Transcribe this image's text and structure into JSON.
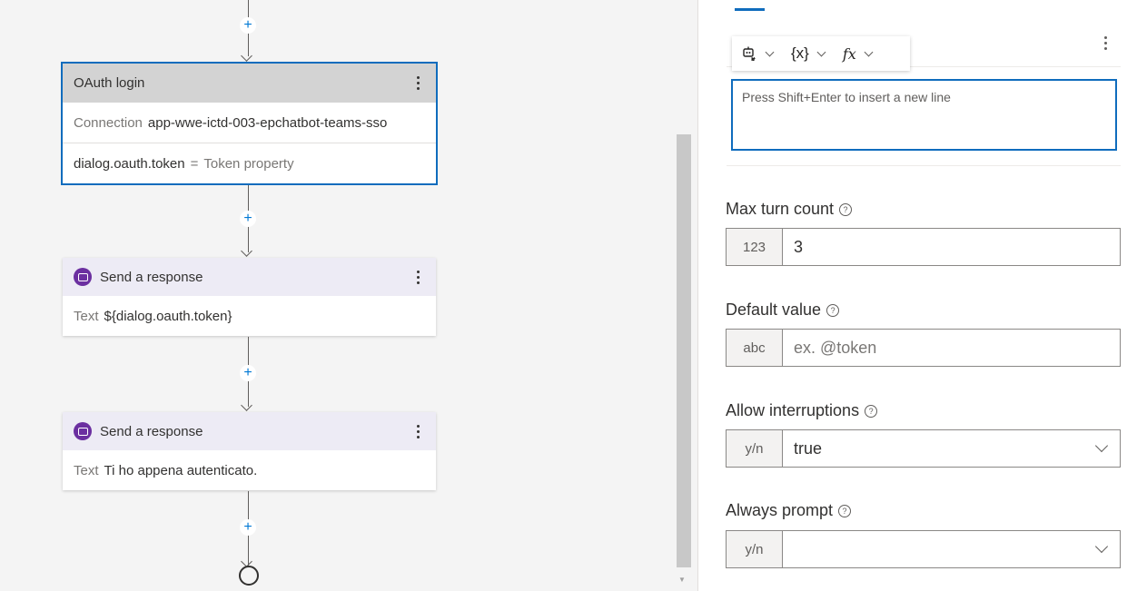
{
  "canvas": {
    "oauth_node": {
      "title": "OAuth login",
      "connection_label": "Connection",
      "connection_value": "app-wwe-ictd-003-epchatbot-teams-sso",
      "token_var": "dialog.oauth.token",
      "token_eq": "=",
      "token_prop": "Token property"
    },
    "response_nodes": [
      {
        "title": "Send a response",
        "text_label": "Text",
        "text_value": "${dialog.oauth.token}"
      },
      {
        "title": "Send a response",
        "text_label": "Text",
        "text_value": "Ti ho appena autenticato."
      }
    ],
    "add_symbol": "+"
  },
  "panel": {
    "toolbar": {
      "var_label": "{x}",
      "fx_label": "fx"
    },
    "prompt_placeholder": "Press Shift+Enter to insert a new line",
    "fields": [
      {
        "label": "Max turn count",
        "prefix": "123",
        "value": "3",
        "placeholder": ""
      },
      {
        "label": "Default value",
        "prefix": "abc",
        "value": "",
        "placeholder": "ex. @token"
      },
      {
        "label": "Allow interruptions",
        "prefix": "y/n",
        "value": "true",
        "placeholder": ""
      },
      {
        "label": "Always prompt",
        "prefix": "y/n",
        "value": "",
        "placeholder": ""
      }
    ],
    "help_glyph": "?"
  },
  "colors": {
    "accent": "#0f6cbd",
    "bot_icon": "#6b2fa0",
    "oauth_header": "#d3d3d3",
    "response_header": "#edebf5"
  }
}
